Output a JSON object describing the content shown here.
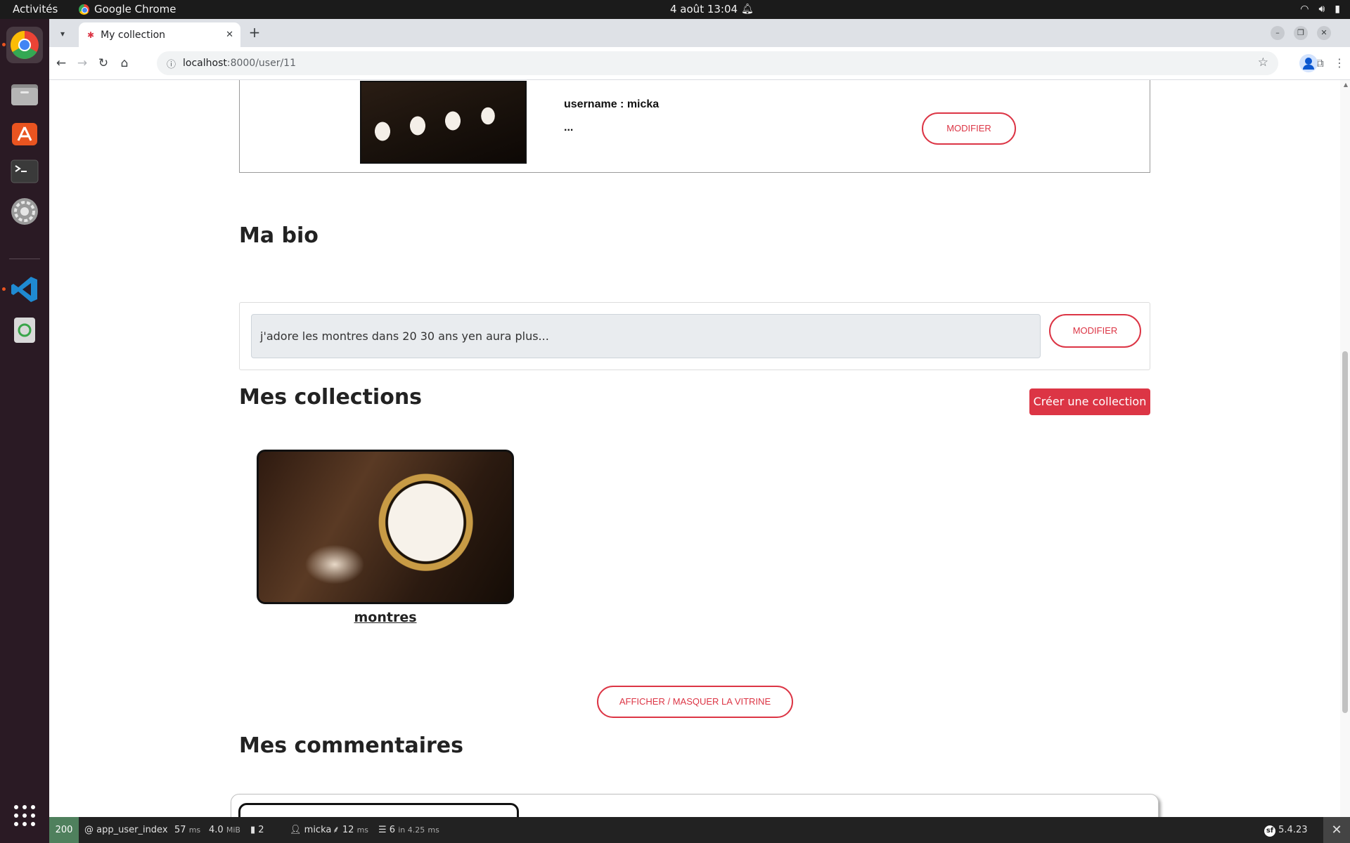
{
  "topbar": {
    "activities": "Activités",
    "app_name": "Google Chrome",
    "clock": "4 août  13:04"
  },
  "dock": {
    "items": [
      {
        "name": "chrome-icon"
      },
      {
        "name": "files-icon"
      },
      {
        "name": "app-center-icon"
      },
      {
        "name": "terminal-icon"
      },
      {
        "name": "settings-icon"
      },
      {
        "name": "vscode-icon"
      },
      {
        "name": "trash-icon"
      }
    ]
  },
  "browser": {
    "tab_title": "My collection",
    "url_host": "localhost",
    "url_path": ":8000/user/11"
  },
  "profile": {
    "username": "username : micka",
    "bio_placeholder": "...",
    "modify_label": "MODIFIER"
  },
  "bio": {
    "title": "Ma bio",
    "value": "j'adore les montres dans 20 30 ans yen aura plus...",
    "modify_label": "MODIFIER"
  },
  "collections": {
    "title": "Mes collections",
    "create_label": "Créer une collection",
    "items": [
      {
        "name": "montres"
      }
    ],
    "toggle_label": "AFFICHER / MASQUER LA VITRINE"
  },
  "comments": {
    "title": "Mes commentaires"
  },
  "profiler": {
    "status": "200",
    "route": "@ app_user_index",
    "time_value": "57",
    "time_unit": "ms",
    "memory_value": "4.0",
    "memory_unit": "MiB",
    "logs_count": "2",
    "user": "micka",
    "twig_value": "12",
    "twig_unit": "ms",
    "db_queries": "6",
    "db_text": "in 4.25",
    "db_unit": "ms",
    "version": "5.4.23"
  },
  "colors": {
    "accent_red": "#dc3545",
    "profiler_ok": "#4f805d"
  }
}
